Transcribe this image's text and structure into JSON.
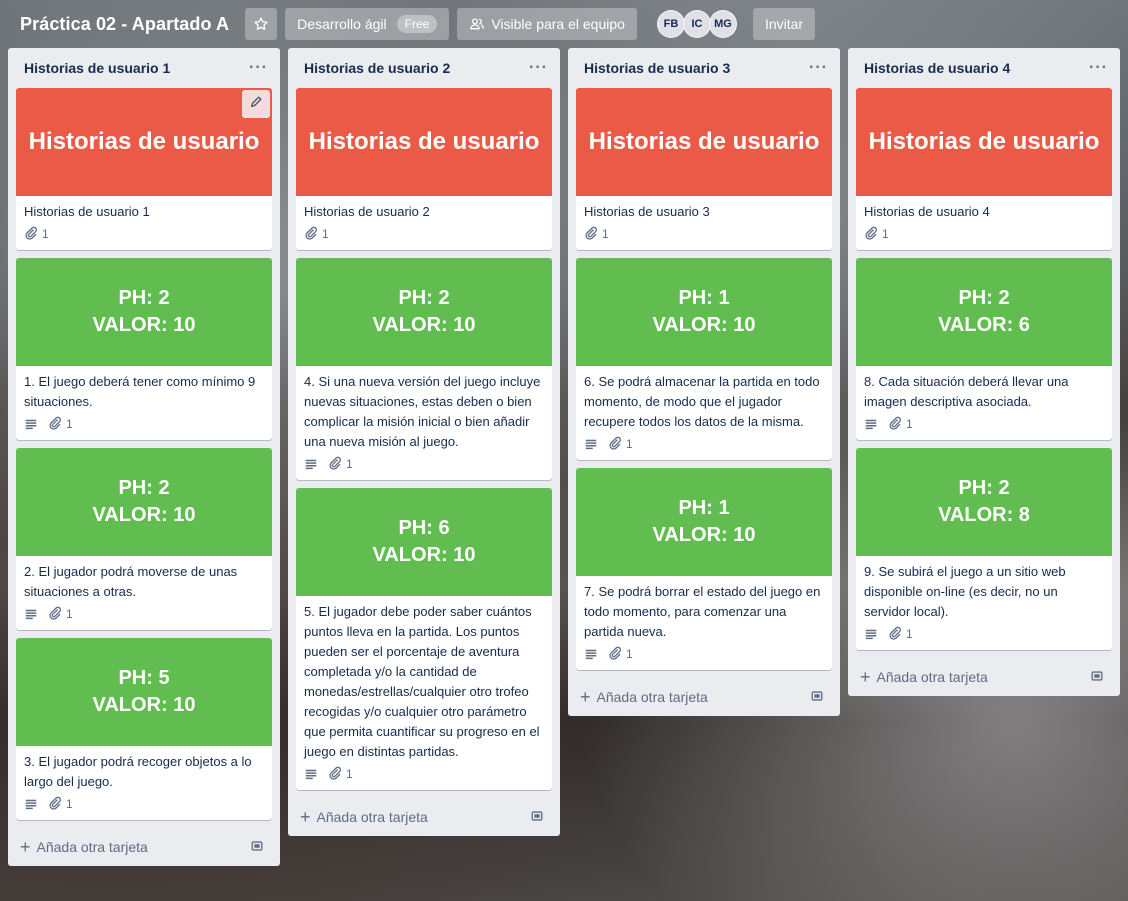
{
  "header": {
    "board_title": "Práctica 02 - Apartado A",
    "workspace_label": "Desarrollo ágil",
    "workspace_badge": "Free",
    "visibility_label": "Visible para el equipo",
    "members": [
      "FB",
      "IC",
      "MG"
    ],
    "invite_label": "Invitar"
  },
  "lists": [
    {
      "title": "Historias de usuario 1",
      "add_label": "Añada otra tarjeta",
      "cards": [
        {
          "cover": "red",
          "cover_lines": [
            "Historias de usuario"
          ],
          "text": "Historias de usuario 1",
          "description": false,
          "attachments": "1"
        },
        {
          "cover": "green",
          "cover_lines": [
            "PH: 2",
            "VALOR: 10"
          ],
          "text": "1. El juego deberá tener como mínimo 9 situaciones.",
          "description": true,
          "attachments": "1"
        },
        {
          "cover": "green",
          "cover_lines": [
            "PH: 2",
            "VALOR: 10"
          ],
          "text": "2. El jugador podrá moverse de unas situaciones a otras.",
          "description": true,
          "attachments": "1"
        },
        {
          "cover": "green",
          "cover_lines": [
            "PH: 5",
            "VALOR: 10"
          ],
          "text": "3. El jugador podrá recoger objetos a lo largo del juego.",
          "description": true,
          "attachments": "1"
        }
      ]
    },
    {
      "title": "Historias de usuario 2",
      "add_label": "Añada otra tarjeta",
      "cards": [
        {
          "cover": "red",
          "cover_lines": [
            "Historias de usuario"
          ],
          "text": "Historias de usuario 2",
          "description": false,
          "attachments": "1"
        },
        {
          "cover": "green",
          "cover_lines": [
            "PH: 2",
            "VALOR: 10"
          ],
          "text": "4. Si una nueva versión del juego incluye nuevas situaciones, estas deben o bien complicar la misión inicial o bien añadir una nueva misión al juego.",
          "description": true,
          "attachments": "1"
        },
        {
          "cover": "green",
          "cover_lines": [
            "PH: 6",
            "VALOR: 10"
          ],
          "text": "5. El jugador debe poder saber cuántos puntos lleva en la partida. Los puntos pueden ser el porcentaje de aventura completada y/o la cantidad de monedas/estrellas/cualquier otro trofeo recogidas y/o cualquier otro parámetro que permita cuantificar su progreso en el juego en distintas partidas.",
          "description": true,
          "attachments": "1"
        }
      ]
    },
    {
      "title": "Historias de usuario 3",
      "add_label": "Añada otra tarjeta",
      "cards": [
        {
          "cover": "red",
          "cover_lines": [
            "Historias de usuario"
          ],
          "text": "Historias de usuario 3",
          "description": false,
          "attachments": "1"
        },
        {
          "cover": "green",
          "cover_lines": [
            "PH: 1",
            "VALOR: 10"
          ],
          "text": "6. Se podrá almacenar la partida en todo momento, de modo que el jugador recupere todos los datos de la misma.",
          "description": true,
          "attachments": "1"
        },
        {
          "cover": "green",
          "cover_lines": [
            "PH: 1",
            "VALOR: 10"
          ],
          "text": "7. Se podrá borrar el estado del juego en todo momento, para comenzar una partida nueva.",
          "description": true,
          "attachments": "1"
        }
      ]
    },
    {
      "title": "Historias de usuario 4",
      "add_label": "Añada otra tarjeta",
      "cards": [
        {
          "cover": "red",
          "cover_lines": [
            "Historias de usuario"
          ],
          "text": "Historias de usuario 4",
          "description": false,
          "attachments": "1"
        },
        {
          "cover": "green",
          "cover_lines": [
            "PH: 2",
            "VALOR: 6"
          ],
          "text": "8. Cada situación deberá llevar una imagen descriptiva asociada.",
          "description": true,
          "attachments": "1"
        },
        {
          "cover": "green",
          "cover_lines": [
            "PH: 2",
            "VALOR: 8"
          ],
          "text": "9. Se subirá el juego a un sitio web disponible on-line (es decir, no un servidor local).",
          "description": true,
          "attachments": "1"
        }
      ]
    }
  ],
  "icons": {
    "star": "star-icon",
    "visibility": "team-icon",
    "description": "description-icon",
    "attachment": "paperclip-icon",
    "template": "template-icon",
    "edit": "pencil-icon",
    "menu": "more-icon"
  }
}
